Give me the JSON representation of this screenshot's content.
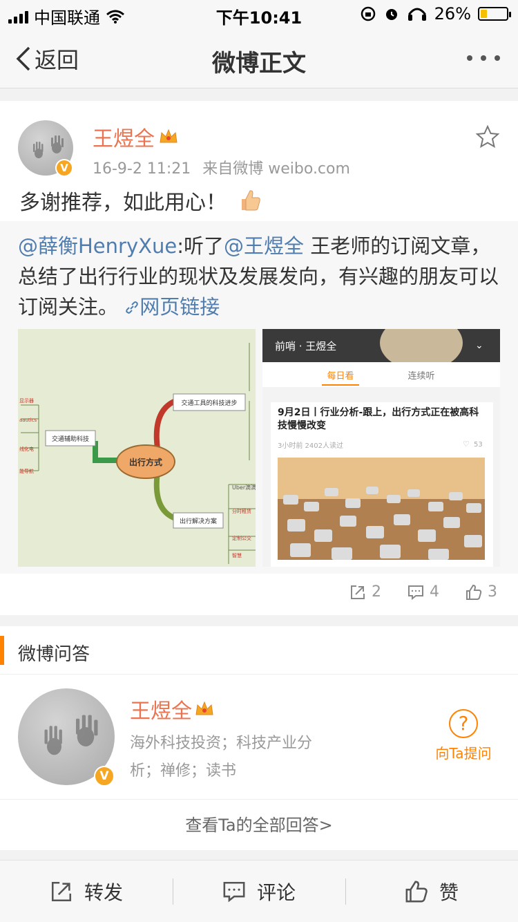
{
  "status_bar": {
    "carrier": "中国联通",
    "time": "下午10:41",
    "battery": "26%",
    "battery_level": 0.26
  },
  "nav": {
    "back_label": "返回",
    "title": "微博正文"
  },
  "post": {
    "author": "王煜全",
    "time": "16-9-2 11:21",
    "source": "来自微博 weibo.com",
    "text": "多谢推荐，如此用心！",
    "repost": {
      "mention1": "@薛衡HenryXue",
      "text1": ":听了",
      "mention2": "@王煜全",
      "text2": " 王老师的订阅文章，总结了出行行业的现状及发展发向，有兴趣的朋友可以订阅关注。",
      "link_label": "网页链接"
    },
    "image1": {
      "center": "出行方式",
      "branch_top": "交通工具的科技进步",
      "branch_left": "交通辅助科技",
      "branch_bottom": "出行解决方案",
      "leaf_uber": "Uber滴滴",
      "leaf_a": "显示器",
      "leaf_b": "aautics",
      "leaf_c": "线化电",
      "leaf_d": "能导航",
      "leaf_e": "分时租赁",
      "leaf_f": "定制公交",
      "leaf_g": "智慧"
    },
    "image2": {
      "header": "前哨 · 王煜全",
      "tab_active": "每日看",
      "tab_other": "连续听",
      "card_title": "9月2日丨行业分析-跟上，出行方式正在被高科技慢慢改变",
      "card_meta": "3小时前   2402人读过",
      "card_likes": "53"
    },
    "counts": {
      "repost": "2",
      "comment": "4",
      "like": "3"
    }
  },
  "qa": {
    "section_title": "微博问答",
    "name": "王煜全",
    "description": "海外科技投资；科技产业分析；禅修；读书",
    "ask_label": "向Ta提问",
    "view_all": "查看Ta的全部回答>"
  },
  "toolbar": {
    "repost": "转发",
    "comment": "评论",
    "like": "赞"
  },
  "colors": {
    "orange": "#ff8200",
    "name": "#eb7350",
    "link": "#507daf",
    "verified": "#f5a623"
  }
}
